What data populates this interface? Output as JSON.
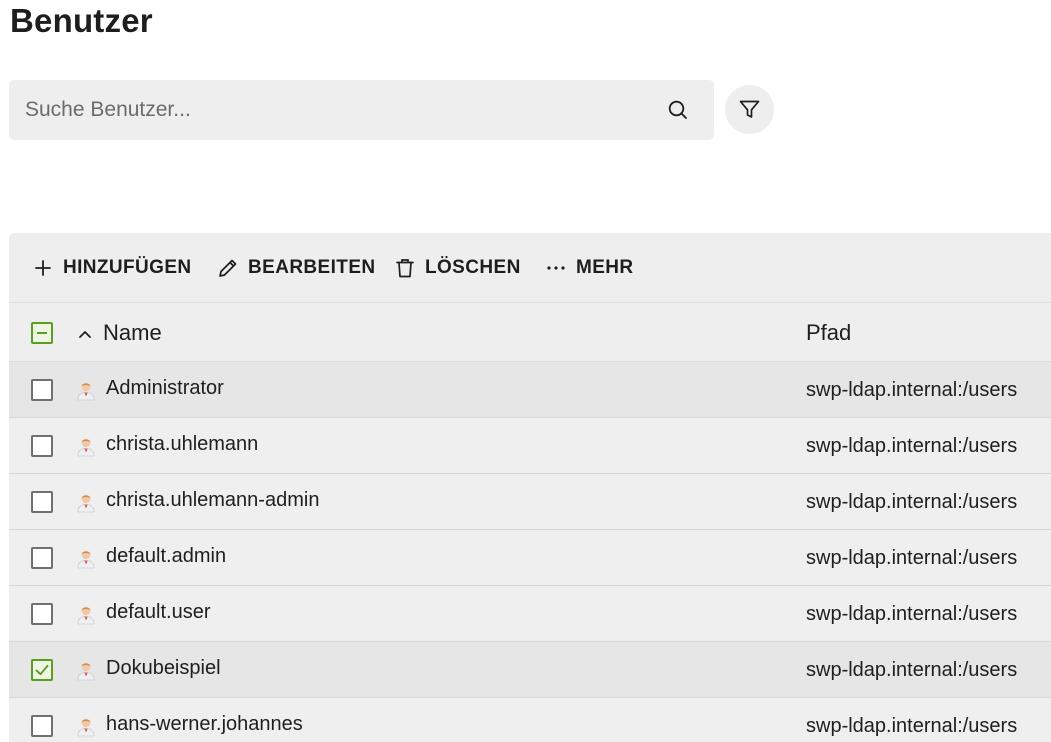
{
  "page": {
    "title": "Benutzer"
  },
  "search": {
    "placeholder": "Suche Benutzer...",
    "value": ""
  },
  "toolbar": {
    "add_label": "HINZUFÜGEN",
    "edit_label": "BEARBEITEN",
    "delete_label": "LÖSCHEN",
    "more_label": "MEHR"
  },
  "table": {
    "columns": {
      "name": "Name",
      "path": "Pfad"
    },
    "sort": {
      "column": "Name",
      "direction": "ascending"
    },
    "header_checkbox_state": "partial",
    "rows": [
      {
        "name": "Administrator",
        "path": "swp-ldap.internal:/users",
        "selected": false
      },
      {
        "name": "christa.uhlemann",
        "path": "swp-ldap.internal:/users",
        "selected": false
      },
      {
        "name": "christa.uhlemann-admin",
        "path": "swp-ldap.internal:/users",
        "selected": false
      },
      {
        "name": "default.admin",
        "path": "swp-ldap.internal:/users",
        "selected": false
      },
      {
        "name": "default.user",
        "path": "swp-ldap.internal:/users",
        "selected": false
      },
      {
        "name": "Dokubeispiel",
        "path": "swp-ldap.internal:/users",
        "selected": true
      },
      {
        "name": "hans-werner.johannes",
        "path": "swp-ldap.internal:/users",
        "selected": false
      }
    ]
  },
  "icons": {
    "search": "search-icon",
    "filter": "filter-icon",
    "add": "plus-icon",
    "edit": "pencil-icon",
    "delete": "trash-icon",
    "more": "more-dots-icon",
    "sort": "chevron-up-icon",
    "user": "user-icon"
  },
  "colors": {
    "accent_checkbox": "#5a9e1e",
    "panel_background": "#eeeeee",
    "text": "#1e1e1e"
  }
}
